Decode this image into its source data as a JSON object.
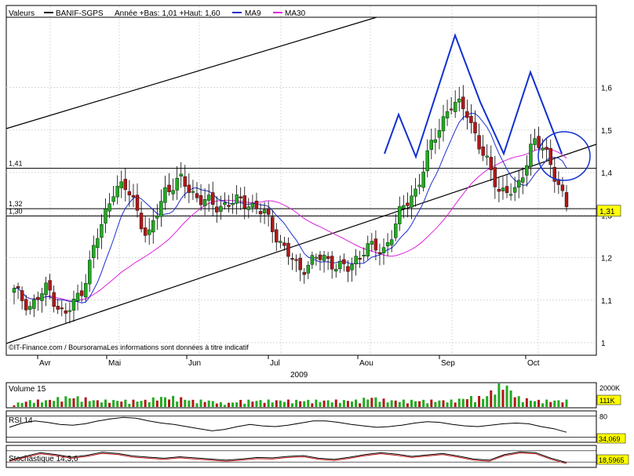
{
  "header": {
    "prefix": "Valeurs",
    "symbol": "BANIF-SGPS",
    "range_text": "Année +Bas: 1,01 +Haut: 1,60",
    "ma9_label": "MA9",
    "ma30_label": "MA30"
  },
  "colors": {
    "up": "#22aa22",
    "down": "#b01818",
    "ma9": "#1d2fcf",
    "ma30": "#dd22dd",
    "volume": "#22aa22",
    "highlight": "#ffff00",
    "circle": "#1030d0",
    "hline": "#000000"
  },
  "footer": {
    "credit": "©IT-Finance.com / BoursoramaLes informations sont données à titre indicatif",
    "year": "2009"
  },
  "chart_data": [
    {
      "type": "candlestick",
      "x_months": [
        "Avr",
        "Mai",
        "Jun",
        "Jul",
        "Aou",
        "Sep",
        "Oct"
      ],
      "y_ticks": [
        "1",
        "1,1",
        "1,2",
        "1,3",
        "1,4",
        "1,5",
        "1,6"
      ],
      "ylim": [
        1.0,
        1.65
      ],
      "grid": true,
      "level_lines": [
        {
          "label": "1,41",
          "value": 1.41
        },
        {
          "label": "1,32",
          "value": 1.315
        },
        {
          "label": "1,30",
          "value": 1.298
        }
      ],
      "last_value_label": "1,31",
      "series": [
        {
          "name": "MA9"
        },
        {
          "name": "MA30"
        }
      ],
      "ohlc_anchors": [
        [
          1.1,
          1.12,
          1.16
        ],
        [
          1.07,
          1.085,
          1.1
        ],
        [
          1.095,
          1.13,
          1.12
        ],
        [
          1.03,
          1.06,
          1.06
        ],
        [
          1.085,
          1.12,
          1.12
        ],
        [
          1.19,
          1.25,
          1.32
        ],
        [
          1.38,
          1.37,
          1.36
        ],
        [
          1.4,
          1.35,
          1.35
        ],
        [
          1.26,
          1.24,
          1.3
        ],
        [
          1.35,
          1.36,
          1.34
        ],
        [
          1.37,
          1.38,
          1.36
        ],
        [
          1.35,
          1.34,
          1.34
        ],
        [
          1.33,
          1.32,
          1.31
        ],
        [
          1.34,
          1.33,
          1.35
        ],
        [
          1.33,
          1.33,
          1.32
        ],
        [
          1.32,
          1.3,
          1.28
        ],
        [
          1.25,
          1.23,
          1.21
        ],
        [
          1.2,
          1.17,
          1.16
        ],
        [
          1.16,
          1.2,
          1.25
        ],
        [
          1.22,
          1.19,
          1.17
        ],
        [
          1.18,
          1.17,
          1.16
        ],
        [
          1.2,
          1.23,
          1.23
        ],
        [
          1.22,
          1.21,
          1.2
        ],
        [
          1.23,
          1.3,
          1.38
        ],
        [
          1.41,
          1.36,
          1.35
        ],
        [
          1.42,
          1.47,
          1.52
        ],
        [
          1.53,
          1.56,
          1.58
        ],
        [
          1.6,
          1.55,
          1.52
        ],
        [
          1.48,
          1.44,
          1.42
        ],
        [
          1.4,
          1.36,
          1.32
        ],
        [
          1.31,
          1.35,
          1.4
        ],
        [
          1.45,
          1.48,
          1.47
        ],
        [
          1.45,
          1.43,
          1.4
        ],
        [
          1.38,
          1.32,
          1.31
        ]
      ]
    },
    {
      "type": "bar",
      "title": "Volume 15",
      "y_ticks": [
        "2000K"
      ],
      "last_value_label": "111K",
      "values": [
        1,
        2,
        2,
        3,
        3,
        2,
        2,
        2,
        2,
        3,
        3,
        2,
        2,
        1,
        2,
        2,
        2,
        2,
        2,
        2,
        2,
        2,
        3,
        2,
        2,
        2,
        2,
        2,
        3,
        3,
        8,
        3,
        2,
        2,
        2
      ]
    },
    {
      "type": "line",
      "title": "RSI 14",
      "y_ticks": [
        "80"
      ],
      "ylim": [
        10,
        90
      ],
      "last_value_label": "34,069",
      "values": [
        48,
        60,
        66,
        62,
        56,
        54,
        58,
        66,
        72,
        76,
        74,
        66,
        60,
        56,
        50,
        44,
        38,
        42,
        50,
        56,
        52,
        50,
        54,
        60,
        66,
        66,
        62,
        56,
        52,
        48,
        50,
        54,
        60,
        64,
        62,
        56,
        52,
        50,
        54,
        58,
        60,
        58,
        50,
        44,
        34
      ]
    },
    {
      "type": "line",
      "title": "Stochastique 14,3,6",
      "last_value_label": "18,5965",
      "values": [
        30,
        50,
        70,
        60,
        46,
        56,
        72,
        66,
        52,
        46,
        40,
        48,
        42,
        36,
        30,
        36,
        44,
        42,
        50,
        54,
        40,
        34,
        46,
        60,
        70,
        62,
        50,
        58,
        66,
        52,
        36,
        30,
        60,
        74,
        70,
        40,
        18
      ]
    }
  ]
}
